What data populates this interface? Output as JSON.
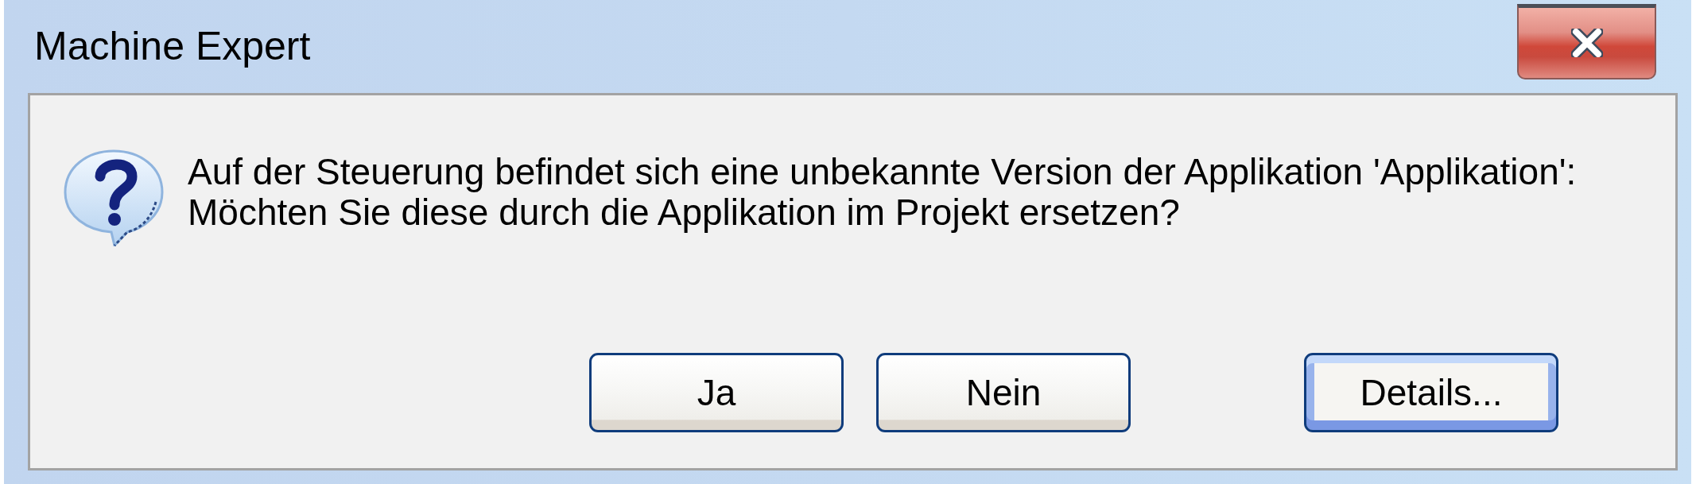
{
  "window": {
    "title": "Machine Expert"
  },
  "message": {
    "text": "Auf der Steuerung befindet sich eine unbekannte Version der Applikation 'Applikation':\nMöchten Sie diese durch die Applikation im Projekt ersetzen?"
  },
  "buttons": [
    {
      "label": "Ja",
      "default": false
    },
    {
      "label": "Nein",
      "default": false
    },
    {
      "label": "Details...",
      "default": true
    }
  ]
}
